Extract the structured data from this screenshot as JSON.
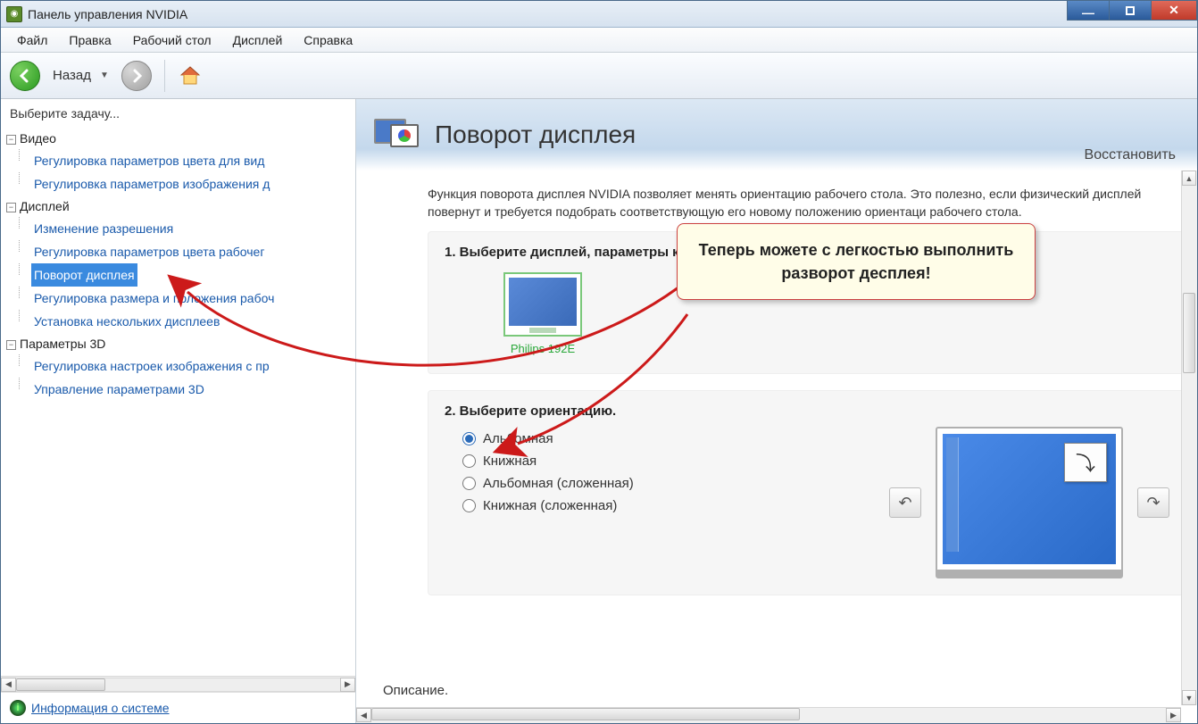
{
  "titlebar": {
    "title": "Панель управления NVIDIA"
  },
  "menu": {
    "file": "Файл",
    "edit": "Правка",
    "desktop": "Рабочий стол",
    "display": "Дисплей",
    "help": "Справка"
  },
  "toolbar": {
    "back": "Назад"
  },
  "left": {
    "header": "Выберите задачу...",
    "video": "Видео",
    "video_items": [
      "Регулировка параметров цвета для вид",
      "Регулировка параметров изображения д"
    ],
    "display": "Дисплей",
    "display_items": [
      "Изменение разрешения",
      "Регулировка параметров цвета рабочег",
      "Поворот дисплея",
      "Регулировка размера и положения рабоч",
      "Установка нескольких дисплеев"
    ],
    "params3d": "Параметры 3D",
    "params3d_items": [
      "Регулировка настроек изображения с пр",
      "Управление параметрами 3D"
    ],
    "sysinfo": "Информация о системе"
  },
  "page": {
    "title": "Поворот дисплея",
    "restore": "Восстановить",
    "desc": "Функция поворота дисплея NVIDIA позволяет менять ориентацию рабочего стола. Это полезно, если физический дисплей повернут и требуется подобрать соответствующую его новому положению ориентаци рабочего стола.",
    "step1": "1. Выберите дисплей, параметры которого требуется изменить.",
    "display_label": "Philips 192E",
    "step2": "2. Выберите ориентацию.",
    "orient": [
      "Альбомная",
      "Книжная",
      "Альбомная (сложенная)",
      "Книжная (сложенная)"
    ],
    "description_label": "Описание."
  },
  "callout": {
    "text": "Теперь можете с легкостью выполнить разворот десплея!"
  }
}
